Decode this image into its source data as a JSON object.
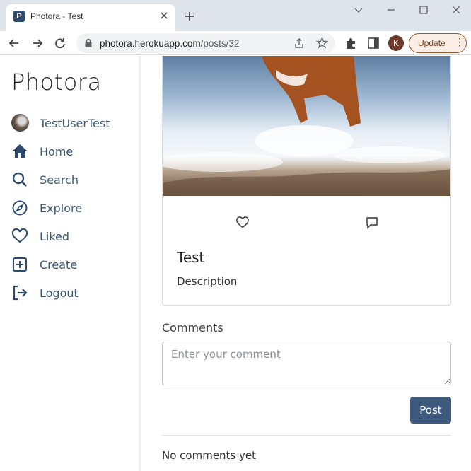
{
  "browser": {
    "tab_title": "Photora - Test",
    "favicon_letter": "P",
    "url_host": "photora.herokuapp.com",
    "url_path": "/posts/32",
    "profile_initial": "K",
    "update_label": "Update"
  },
  "sidebar": {
    "logo": "Photora",
    "user": {
      "label": "TestUserTest"
    },
    "items": [
      {
        "label": "Home",
        "icon": "home-icon"
      },
      {
        "label": "Search",
        "icon": "search-icon"
      },
      {
        "label": "Explore",
        "icon": "compass-icon"
      },
      {
        "label": "Liked",
        "icon": "heart-icon"
      },
      {
        "label": "Create",
        "icon": "plus-square-icon"
      },
      {
        "label": "Logout",
        "icon": "logout-icon"
      }
    ]
  },
  "post": {
    "title": "Test",
    "description": "Description"
  },
  "comments": {
    "heading": "Comments",
    "placeholder": "Enter your comment",
    "post_button": "Post",
    "empty_text": "No comments yet"
  },
  "colors": {
    "accent": "#3d5a7c",
    "nav_text": "#3a5877"
  }
}
